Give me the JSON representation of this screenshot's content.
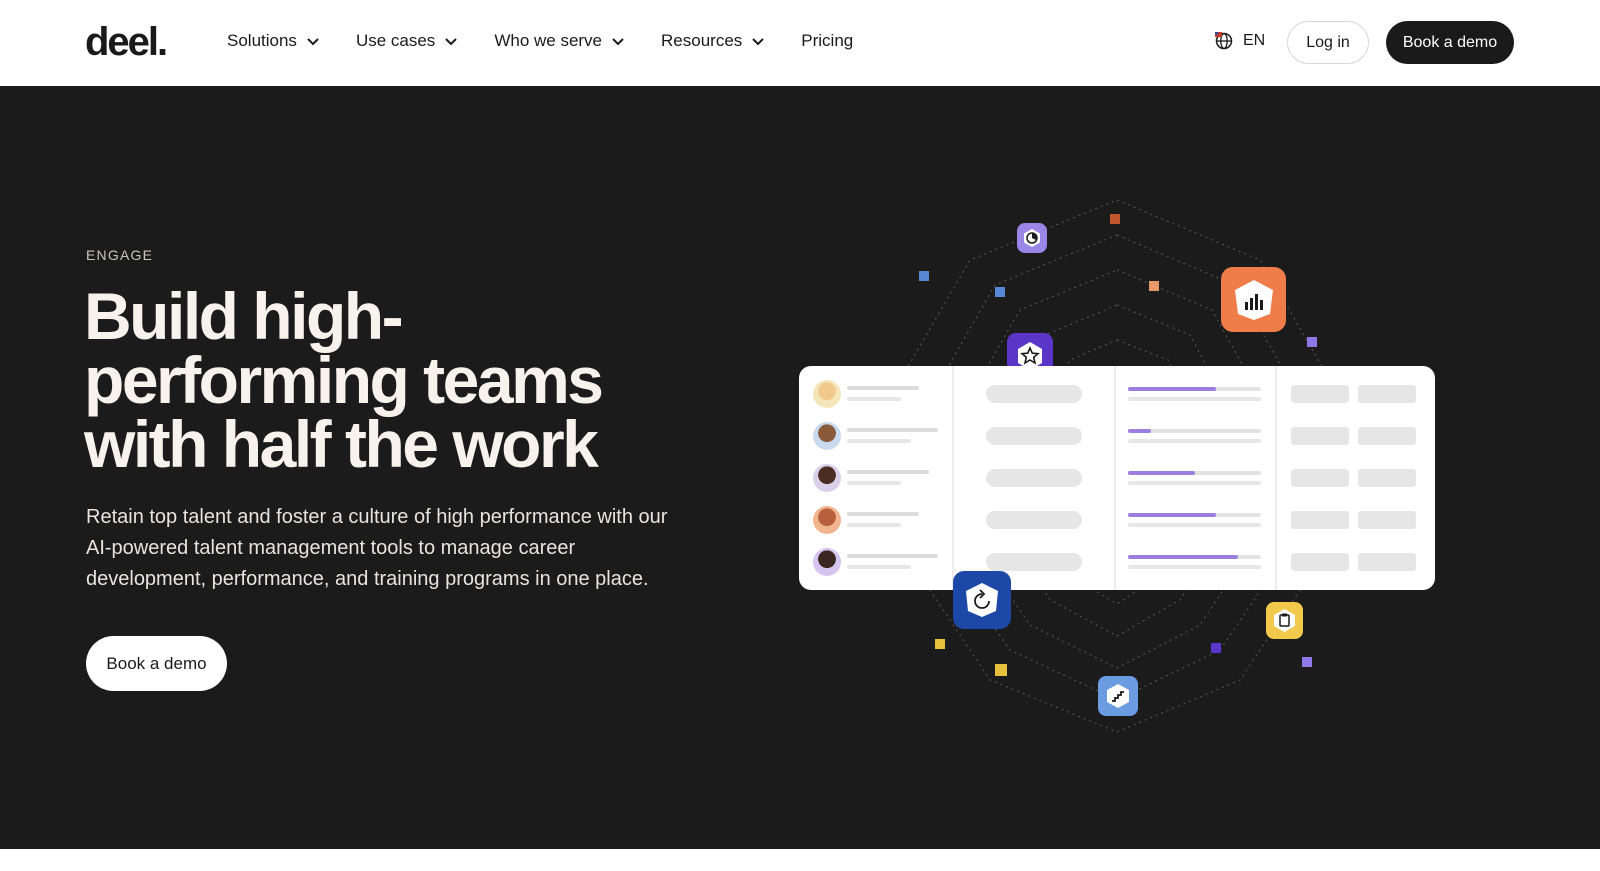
{
  "header": {
    "logo": "deel.",
    "nav": [
      {
        "label": "Solutions",
        "has_dropdown": true
      },
      {
        "label": "Use cases",
        "has_dropdown": true
      },
      {
        "label": "Who we serve",
        "has_dropdown": true
      },
      {
        "label": "Resources",
        "has_dropdown": true
      },
      {
        "label": "Pricing",
        "has_dropdown": false
      }
    ],
    "language": "EN",
    "language_icon": "globe-icon",
    "login_label": "Log in",
    "demo_label": "Book a demo"
  },
  "hero": {
    "eyebrow": "ENGAGE",
    "headline": "Build high-performing teams with half the work",
    "subtext": "Retain top talent and foster a culture of high performance with our AI-powered talent management tools to manage career development, performance, and training programs in one place.",
    "cta_label": "Book a demo"
  },
  "illustration": {
    "badges": [
      {
        "icon": "pie-chart-icon",
        "color": "#9b86e8"
      },
      {
        "icon": "star-badge-icon",
        "color": "#5b35c8"
      },
      {
        "icon": "bar-chart-icon",
        "color": "#ef7d4a"
      },
      {
        "icon": "refresh-icon",
        "color": "#1e48a8"
      },
      {
        "icon": "clipboard-icon",
        "color": "#f2c94c"
      },
      {
        "icon": "stairs-icon",
        "color": "#6b9be0"
      }
    ],
    "rows": [
      {
        "avatar": "avatar-1",
        "progress": 0.66
      },
      {
        "avatar": "avatar-2",
        "progress": 0.17
      },
      {
        "avatar": "avatar-3",
        "progress": 0.5
      },
      {
        "avatar": "avatar-4",
        "progress": 0.66
      },
      {
        "avatar": "avatar-5",
        "progress": 0.83
      }
    ]
  },
  "colors": {
    "hero_bg": "#1c1b1b",
    "headline": "#f7f2ec",
    "accent_purple": "#9b7ee0",
    "button_dark": "#1a1a1a"
  }
}
